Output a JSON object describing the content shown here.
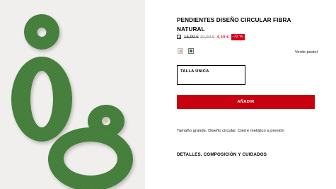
{
  "product": {
    "title": "PENDIENTES DISEÑO CIRCULAR FIBRA NATURAL",
    "image_alt": "green-woven-circular-earrings",
    "price": {
      "info_icon": "price-info-icon",
      "original": "15,99 €",
      "previous": "10,99 €",
      "sale": "4,49 €",
      "discount": "-72 %"
    },
    "colors": [
      {
        "name": "pink-pattern",
        "hex": "#c8a4ae"
      },
      {
        "name": "Verde pastel",
        "hex": "#3f6d39"
      }
    ],
    "selected_color_name": "Verde pastel",
    "size": {
      "selected": "TALLA ÚNICA"
    },
    "add_button_label": "AÑADIR",
    "description": "Tamaño grande. Diseño circular. Cierre metálico a presión",
    "details_link": "DETALLES, COMPOSICIÓN Y CUIDADOS"
  },
  "theme": {
    "accent": "#c8000f",
    "sale": "#d0021b",
    "image_bg": "#f0efed",
    "earring_green": "#4f8a45"
  }
}
